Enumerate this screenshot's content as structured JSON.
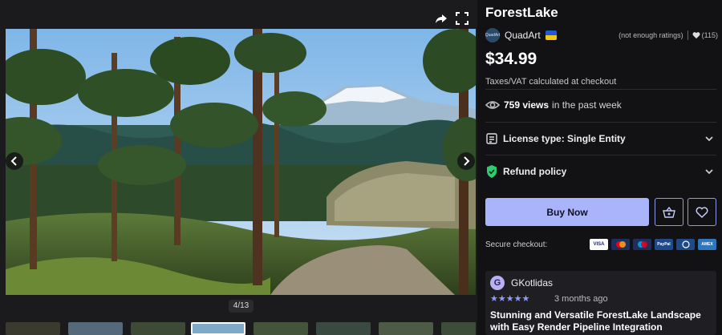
{
  "gallery": {
    "counter": "4/13",
    "thumbnail_count": 8,
    "active_thumbnail": 4
  },
  "product": {
    "title": "ForestLake",
    "seller": "QuadArt",
    "seller_avatar_text": "QuadArt",
    "ratings_note": "(not enough ratings)",
    "likes": "(115)",
    "price": "$34.99",
    "tax_note": "Taxes/VAT calculated at checkout"
  },
  "views": {
    "count": "759 views",
    "suffix": "in the past week"
  },
  "license": {
    "label": "License type: Single Entity"
  },
  "refund": {
    "label": "Refund policy"
  },
  "actions": {
    "buy_label": "Buy Now"
  },
  "checkout": {
    "label": "Secure checkout:",
    "cards": [
      {
        "name": "visa",
        "text": "VISA"
      },
      {
        "name": "mastercard",
        "text": ""
      },
      {
        "name": "maestro",
        "text": ""
      },
      {
        "name": "paypal",
        "text": "PayPal"
      },
      {
        "name": "diners",
        "text": ""
      },
      {
        "name": "amex",
        "text": "AMEX"
      }
    ]
  },
  "review": {
    "initial": "G",
    "author": "GKotlidas",
    "stars": "★★★★★",
    "rating": 5,
    "time": "3 months ago",
    "title": "Stunning and Versatile ForestLake Landscape with Easy Render Pipeline Integration"
  },
  "colors": {
    "accent": "#a9b4fb",
    "background": "#121214",
    "star": "#8f9cff"
  }
}
